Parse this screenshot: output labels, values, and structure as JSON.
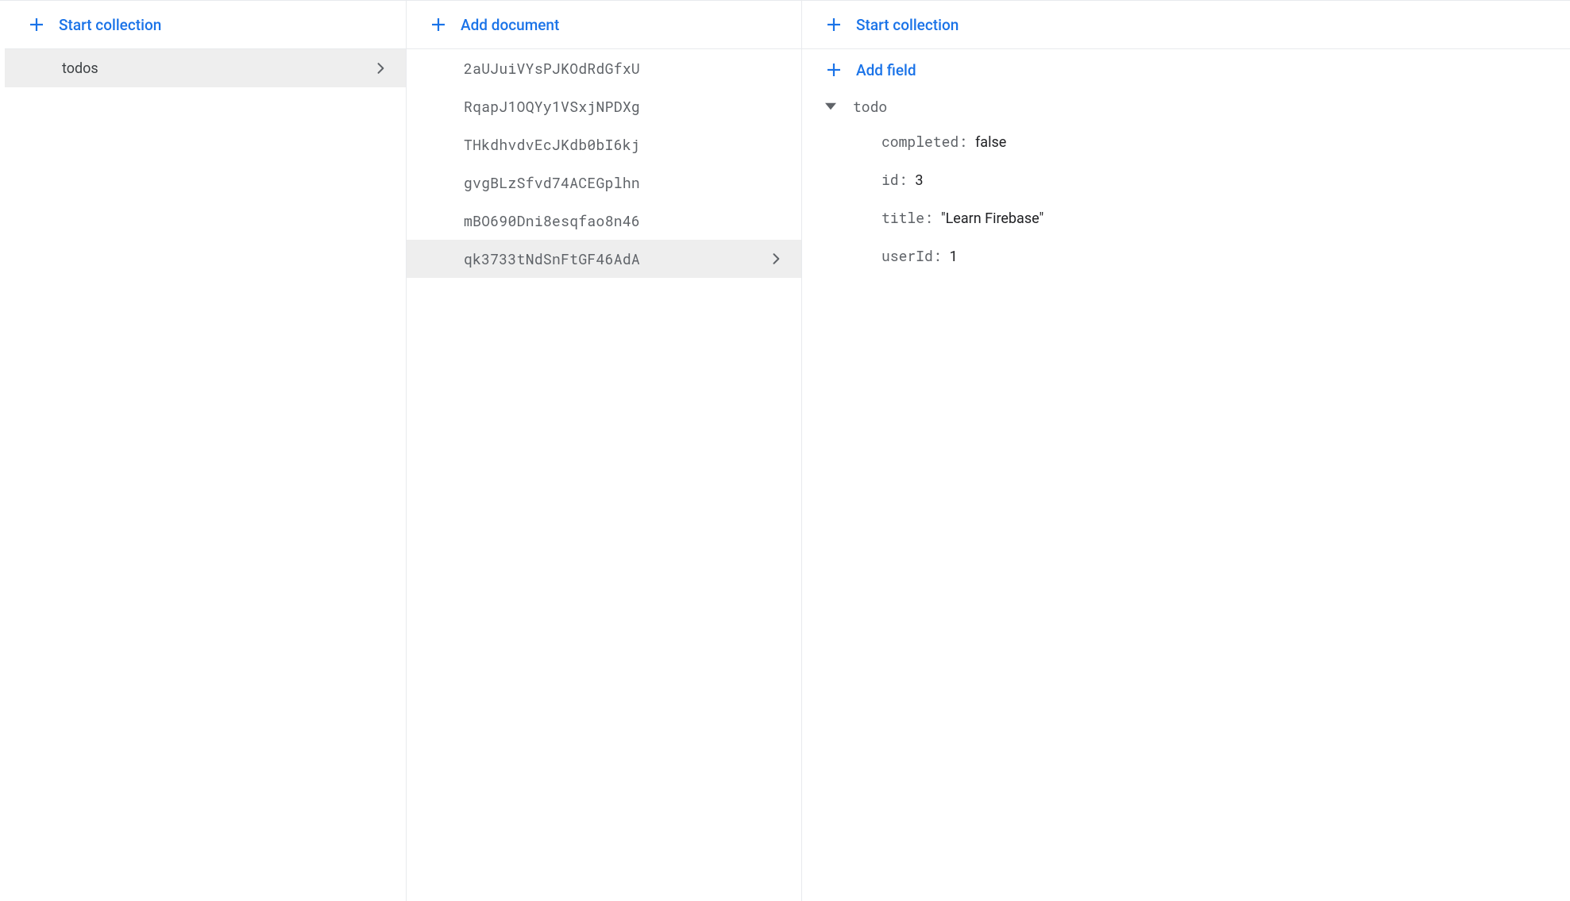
{
  "collections_panel": {
    "start_collection_label": "Start collection",
    "items": [
      {
        "name": "todos",
        "selected": true
      }
    ]
  },
  "documents_panel": {
    "add_document_label": "Add document",
    "items": [
      {
        "id": "2aUJuiVYsPJKOdRdGfxU",
        "selected": false
      },
      {
        "id": "RqapJ1OQYy1VSxjNPDXg",
        "selected": false
      },
      {
        "id": "THkdhvdvEcJKdb0bI6kj",
        "selected": false
      },
      {
        "id": "gvgBLzSfvd74ACEGplhn",
        "selected": false
      },
      {
        "id": "mBO690Dni8esqfao8n46",
        "selected": false
      },
      {
        "id": "qk3733tNdSnFtGF46AdA",
        "selected": true
      }
    ]
  },
  "fields_panel": {
    "start_collection_label": "Start collection",
    "add_field_label": "Add field",
    "object": {
      "name": "todo",
      "fields": [
        {
          "key": "completed",
          "value": "false"
        },
        {
          "key": "id",
          "value": "3"
        },
        {
          "key": "title",
          "value": "\"Learn Firebase\""
        },
        {
          "key": "userId",
          "value": "1"
        }
      ]
    }
  }
}
